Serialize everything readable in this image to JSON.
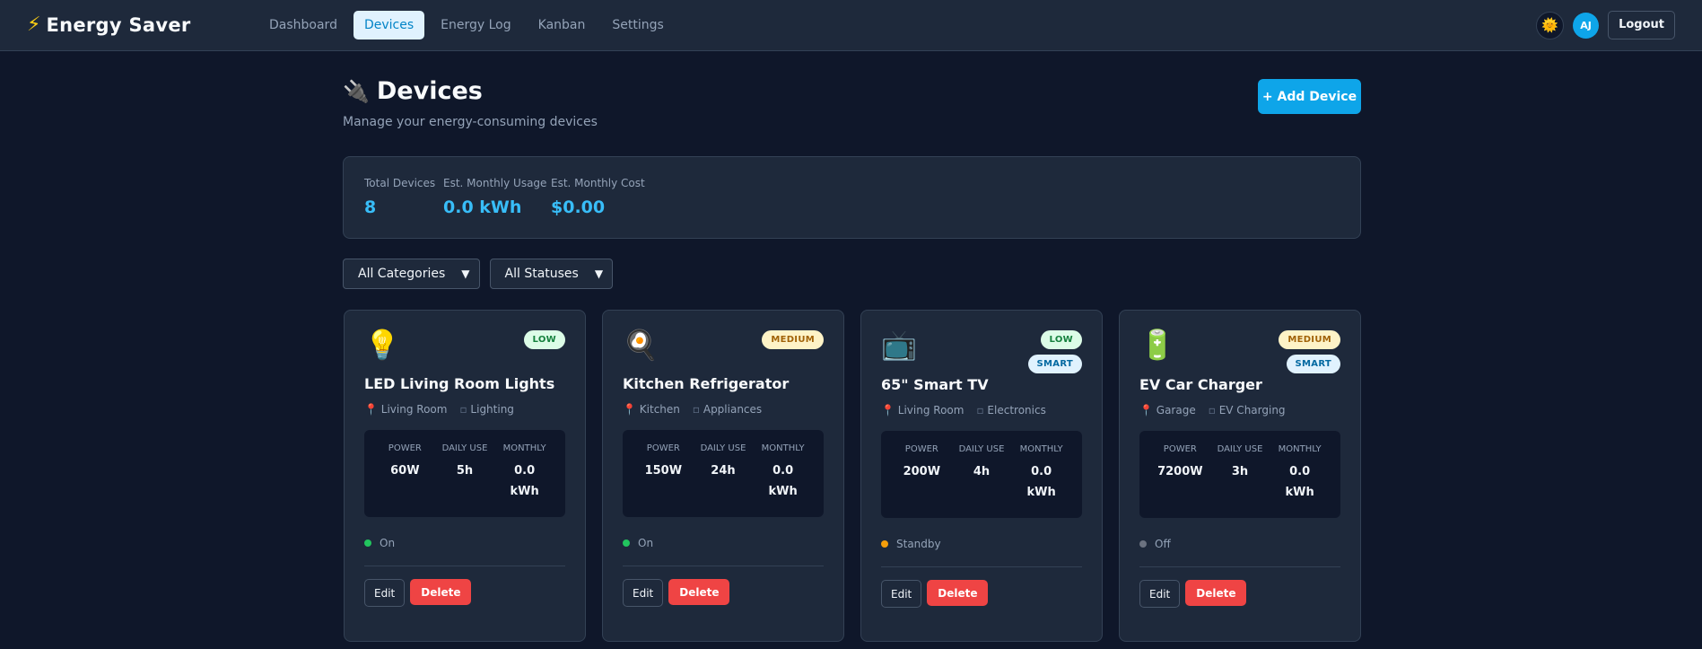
{
  "nav": {
    "brand_icon": "⚡",
    "brand_name": "Energy Saver",
    "links": [
      {
        "label": "Dashboard",
        "active": false
      },
      {
        "label": "Devices",
        "active": true
      },
      {
        "label": "Energy Log",
        "active": false
      },
      {
        "label": "Kanban",
        "active": false
      },
      {
        "label": "Settings",
        "active": false
      }
    ],
    "theme_icon": "🌞",
    "avatar_initials": "AJ",
    "logout_label": "Logout"
  },
  "page": {
    "icon": "🔌",
    "title": "Devices",
    "subtitle": "Manage your energy-consuming devices",
    "add_button": "+ Add Device"
  },
  "stats": [
    {
      "label": "Total Devices",
      "value": "8"
    },
    {
      "label": "Est. Monthly Usage",
      "value": "0.0 kWh"
    },
    {
      "label": "Est. Monthly Cost",
      "value": "$0.00"
    }
  ],
  "filters": {
    "category": "All Categories",
    "status": "All Statuses"
  },
  "metric_labels": {
    "power": "POWER",
    "daily": "DAILY USE",
    "monthly": "MONTHLY"
  },
  "action_labels": {
    "edit": "Edit",
    "delete": "Delete"
  },
  "devices": [
    {
      "icon": "💡",
      "priority": "LOW",
      "priority_class": "low",
      "smart": "",
      "name": "LED Living Room Lights",
      "location": "Living Room",
      "category": "Lighting",
      "power": "60W",
      "daily": "5h",
      "monthly_value": "0.0",
      "monthly_unit": "kWh",
      "status": "On",
      "status_color": "#22c55e"
    },
    {
      "icon": "🍳",
      "priority": "MEDIUM",
      "priority_class": "medium",
      "smart": "",
      "name": "Kitchen Refrigerator",
      "location": "Kitchen",
      "category": "Appliances",
      "power": "150W",
      "daily": "24h",
      "monthly_value": "0.0",
      "monthly_unit": "kWh",
      "status": "On",
      "status_color": "#22c55e"
    },
    {
      "icon": "📺",
      "priority": "LOW",
      "priority_class": "low",
      "smart": "SMART",
      "name": "65\" Smart TV",
      "location": "Living Room",
      "category": "Electronics",
      "power": "200W",
      "daily": "4h",
      "monthly_value": "0.0",
      "monthly_unit": "kWh",
      "status": "Standby",
      "status_color": "#f59e0b"
    },
    {
      "icon": "🔋",
      "priority": "MEDIUM",
      "priority_class": "medium",
      "smart": "SMART",
      "name": "EV Car Charger",
      "location": "Garage",
      "category": "EV Charging",
      "power": "7200W",
      "daily": "3h",
      "monthly_value": "0.0",
      "monthly_unit": "kWh",
      "status": "Off",
      "status_color": "#6b7280"
    }
  ]
}
